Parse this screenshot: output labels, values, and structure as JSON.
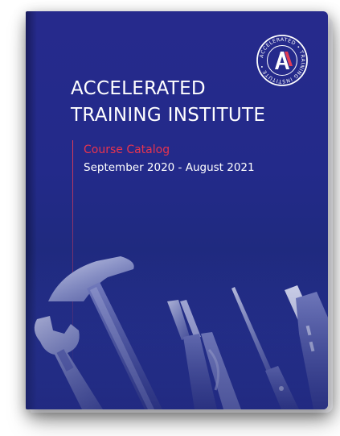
{
  "cover": {
    "title_line1": "ACCELERATED",
    "title_line2": "TRAINING INSTITUTE",
    "subtitle": "Course Catalog",
    "dates": "September 2020 - August 2021"
  },
  "logo": {
    "ring_text": "ACCELERATED TRAINING INSTITUTE",
    "monogram": "A",
    "accent_color": "#e23c55"
  },
  "colors": {
    "cover_bg": "#242a8a",
    "accent": "#e8344e",
    "text": "#ffffff"
  },
  "icons": [
    "hammer-icon",
    "wrench-icon",
    "pliers-icon",
    "screwdriver-icon",
    "utility-knife-icon"
  ]
}
